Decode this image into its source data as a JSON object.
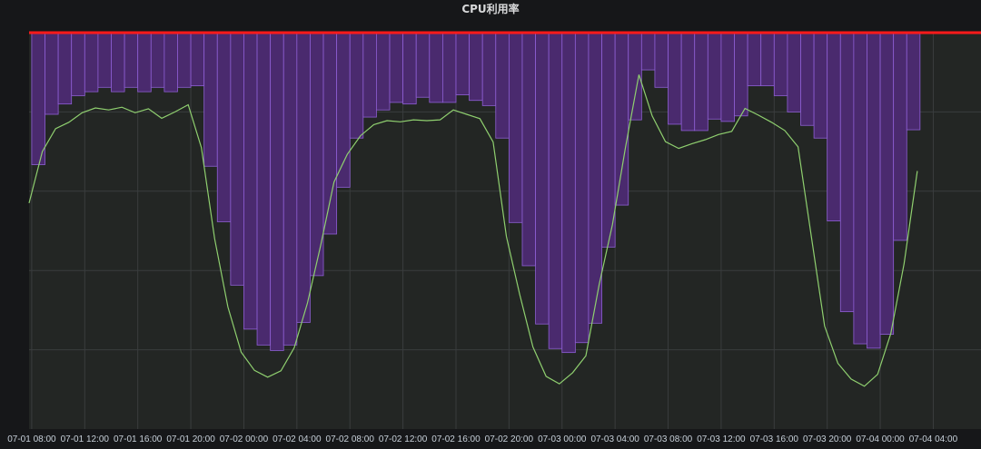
{
  "panel": {
    "title": "CPU利用率"
  },
  "chart_data": {
    "type": "bar",
    "title": "CPU利用率",
    "ylim": [
      0,
      100
    ],
    "grid": true,
    "colors": {
      "background": "#161719",
      "plot_area": "#232624",
      "bar_fill": "#4a2a6e",
      "bar_edge": "#8e5fd4",
      "line": "#8fcf6f",
      "threshold": "#ff1a1a",
      "grid": "#3a3d3e"
    },
    "x_ticks": [
      "07-01 08:00",
      "07-01 12:00",
      "07-01 16:00",
      "07-01 20:00",
      "07-02 00:00",
      "07-02 04:00",
      "07-02 08:00",
      "07-02 12:00",
      "07-02 16:00",
      "07-02 20:00",
      "07-03 00:00",
      "07-03 04:00",
      "07-03 08:00",
      "07-03 12:00",
      "07-03 16:00",
      "07-03 20:00",
      "07-04 00:00",
      "07-04 04:00"
    ],
    "x_hours": [
      8,
      12,
      16,
      20,
      24,
      28,
      32,
      36,
      40,
      44,
      48,
      52,
      56,
      60,
      64,
      68,
      72,
      76
    ],
    "x_range": [
      7.8,
      79.6
    ],
    "threshold": 100,
    "series": [
      {
        "kind": "bar",
        "interval_hours": 1,
        "start_hour": 8,
        "values": [
          66.7,
          79.4,
          82.0,
          84.1,
          85.1,
          86.2,
          85.1,
          86.2,
          85.1,
          86.2,
          85.1,
          86.2,
          86.6,
          66.3,
          52.3,
          36.3,
          25.2,
          21.2,
          19.8,
          21.2,
          26.9,
          38.7,
          49.2,
          61.0,
          73.4,
          78.7,
          80.5,
          82.4,
          82.0,
          83.7,
          82.4,
          82.4,
          84.3,
          82.9,
          81.6,
          73.4,
          52.1,
          41.2,
          26.5,
          20.3,
          19.3,
          21.8,
          26.7,
          45.9,
          56.5,
          78.0,
          90.6,
          86.2,
          76.9,
          75.3,
          75.3,
          78.2,
          77.6,
          79.0,
          86.6,
          86.6,
          84.1,
          80.0,
          76.6,
          73.4,
          52.5,
          29.6,
          21.5,
          20.4,
          23.9,
          47.6,
          75.5
        ]
      },
      {
        "kind": "line",
        "interval_hours": 1,
        "start_hour": 7.8,
        "values": [
          57.0,
          70.0,
          75.8,
          77.4,
          79.8,
          81.0,
          80.5,
          81.2,
          79.8,
          80.8,
          78.4,
          80.0,
          81.8,
          71.0,
          48.0,
          30.8,
          19.4,
          14.8,
          13.1,
          14.7,
          20.5,
          31.8,
          46.4,
          62.3,
          69.3,
          74.0,
          76.8,
          77.8,
          77.5,
          78.0,
          77.8,
          78.0,
          80.5,
          79.4,
          78.3,
          72.4,
          48.6,
          34.0,
          20.7,
          13.3,
          11.4,
          14.2,
          18.5,
          36.4,
          51.5,
          71.3,
          89.4,
          79.0,
          72.5,
          70.8,
          72.0,
          73.0,
          74.3,
          75.1,
          80.9,
          79.2,
          77.4,
          75.3,
          71.2,
          48.6,
          26.0,
          16.6,
          12.6,
          10.8,
          13.8,
          24.1,
          41.7,
          65.1
        ]
      }
    ]
  }
}
